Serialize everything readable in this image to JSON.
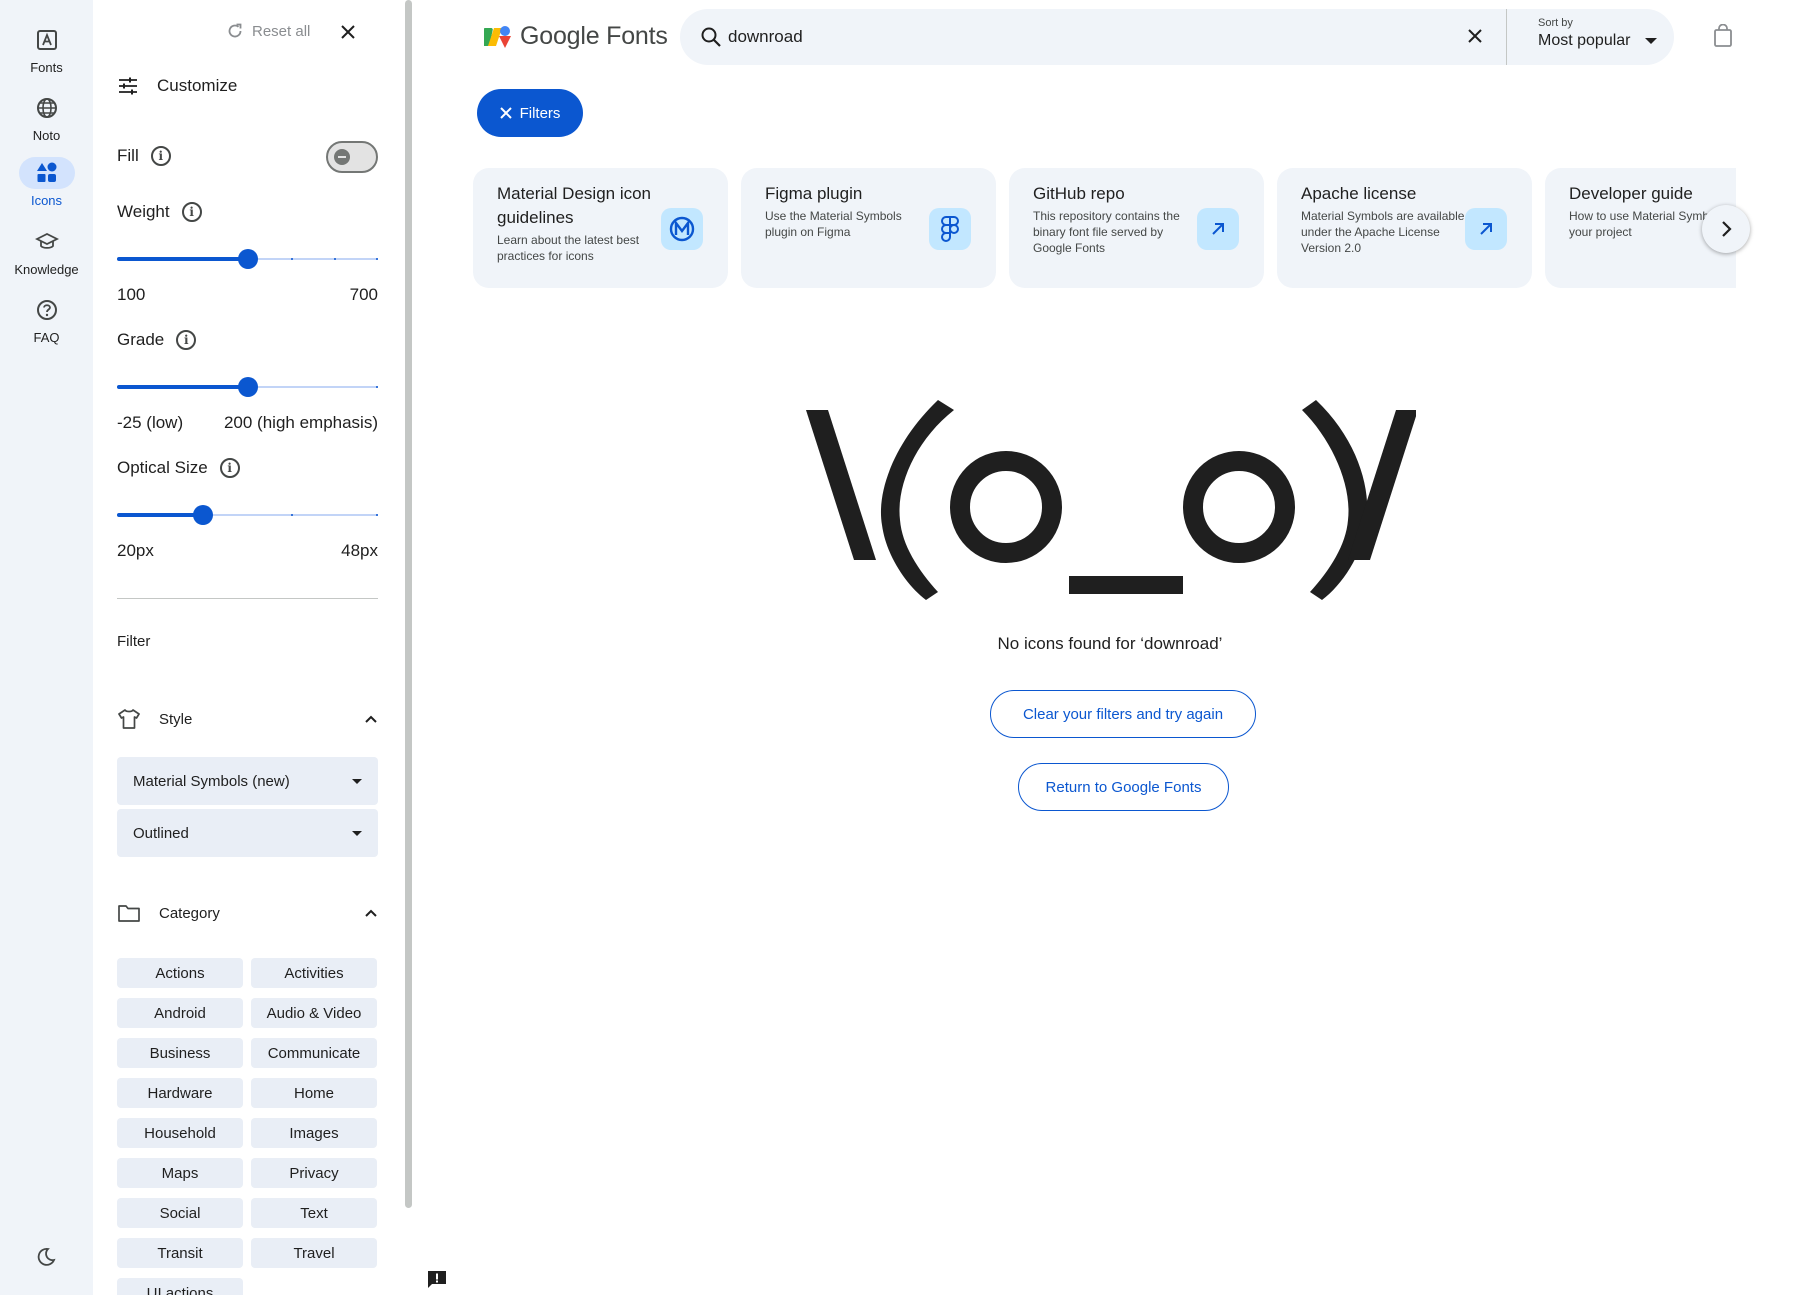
{
  "rail": {
    "items": [
      {
        "label": "Fonts",
        "icon": "fonts-icon"
      },
      {
        "label": "Noto",
        "icon": "globe-icon"
      },
      {
        "label": "Icons",
        "icon": "icons-icon",
        "active": true
      },
      {
        "label": "Knowledge",
        "icon": "school-icon"
      },
      {
        "label": "FAQ",
        "icon": "help-icon"
      }
    ],
    "theme_icon": "dark-mode-icon"
  },
  "panel": {
    "reset_label": "Reset all",
    "customize_label": "Customize",
    "fill": {
      "label": "Fill",
      "on": false
    },
    "weight": {
      "label": "Weight",
      "min_label": "100",
      "max_label": "700",
      "value_fraction": 0.5
    },
    "grade": {
      "label": "Grade",
      "min_label": "-25 (low)",
      "max_label": "200 (high emphasis)",
      "value_fraction": 0.5
    },
    "optical_size": {
      "label": "Optical Size",
      "min_label": "20px",
      "max_label": "48px",
      "value_fraction": 0.33
    },
    "filter_label": "Filter",
    "style": {
      "label": "Style",
      "family": "Material Symbols (new)",
      "variant": "Outlined"
    },
    "category": {
      "label": "Category",
      "chips": [
        "Actions",
        "Activities",
        "Android",
        "Audio & Video",
        "Business",
        "Communicate",
        "Hardware",
        "Home",
        "Household",
        "Images",
        "Maps",
        "Privacy",
        "Social",
        "Text",
        "Transit",
        "Travel",
        "UI actions"
      ]
    }
  },
  "header": {
    "logo_text": "Google Fonts",
    "search_value": "downroad",
    "sort_caption": "Sort by",
    "sort_value": "Most popular"
  },
  "filters_label": "Filters",
  "cards": [
    {
      "title": "Material Design icon guidelines",
      "desc": "Learn about the latest best practices for icons",
      "icon": "material-logo-icon"
    },
    {
      "title": "Figma plugin",
      "desc": "Use the Material Symbols plugin on Figma",
      "icon": "figma-icon"
    },
    {
      "title": "GitHub repo",
      "desc": "This repository contains the binary font file served by Google Fonts",
      "icon": "arrow-outward-icon"
    },
    {
      "title": "Apache license",
      "desc": "Material Symbols are available under the Apache License Version 2.0",
      "icon": "arrow-outward-icon"
    },
    {
      "title": "Developer guide",
      "desc": "How to use Material Symbols in your project",
      "icon": "arrow-outward-icon"
    }
  ],
  "empty": {
    "art": "\\(o_o)/",
    "message": "No icons found for ‘downroad’",
    "clear_label": "Clear your filters and try again",
    "return_label": "Return to Google Fonts"
  },
  "colors": {
    "accent": "#0b57d0",
    "rail_bg": "#f0f4f9",
    "chip_bg": "#e9eef6"
  }
}
